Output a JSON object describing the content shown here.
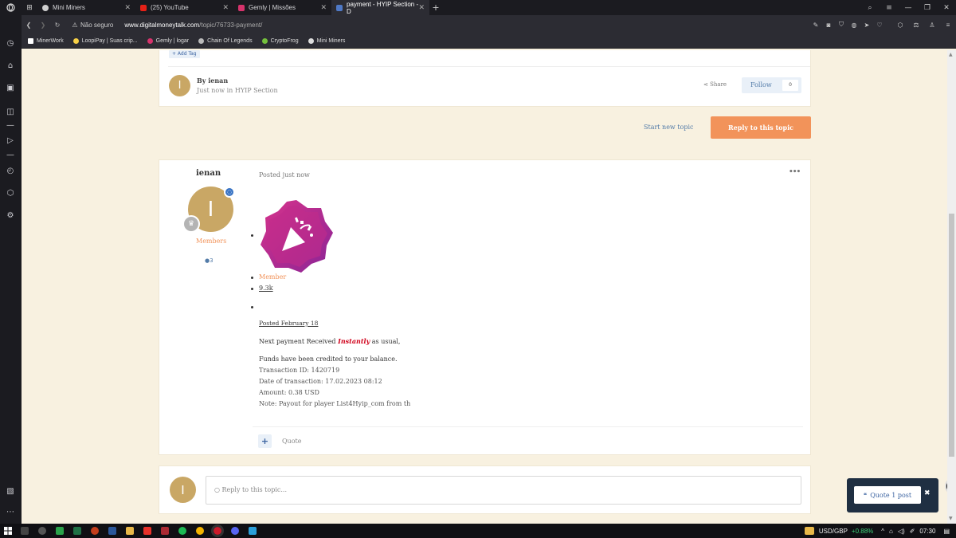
{
  "browser": {
    "tabs": [
      {
        "label": "Mini Miners",
        "color": "#cfcfcf"
      },
      {
        "label": "(25) YouTube",
        "color": "#e62117"
      },
      {
        "label": "Gemly | Missões",
        "color": "#d6336c"
      },
      {
        "label": "payment - HYIP Section - D",
        "color": "#4f79c6"
      }
    ],
    "new_tab": "+",
    "security_label": "Não seguro",
    "url_domain": "www.digitalmoneytalk.com",
    "url_path": "/topic/76733-payment/",
    "bookmarks": [
      {
        "label": "MinerWork",
        "color": "#ffffff"
      },
      {
        "label": "LoopiPay | Suas crip...",
        "color": "#f7d046"
      },
      {
        "label": "Gemly | logar",
        "color": "#d6336c"
      },
      {
        "label": "Chain Of Legends",
        "color": "#bbbbbb"
      },
      {
        "label": "CryptoFrog",
        "color": "#74c03c"
      },
      {
        "label": "Mini Miners",
        "color": "#dddddd"
      }
    ]
  },
  "topic_header": {
    "add_tag": "+ Add Tag",
    "avatar_letter": "I",
    "by_label": "By ienan",
    "meta": "Just now in HYIP Section",
    "share_label": "Share",
    "follow_label": "Follow",
    "follow_count": "0"
  },
  "actions": {
    "start_new_topic": "Start new topic",
    "reply_to_topic": "Reply to this topic"
  },
  "post": {
    "author": "ienan",
    "avatar_letter": "I",
    "group": "Members",
    "post_count": "3",
    "posted": "Posted just now",
    "menu": "•••",
    "badge_label": "Member",
    "reputation": "9.3k",
    "posted_date": "Posted February 18",
    "line1_prefix": "Next payment Received ",
    "line1_emphasis": "Instantly",
    "line1_suffix": " as usual,",
    "funds_line": "Funds have been credited to your balance.",
    "transaction_id": "Transaction ID: 1420719",
    "date_of_transaction": "Date of transaction: 17.02.2023 08:12",
    "amount": "Amount: 0.38 USD",
    "note": "Note: Payout for player List4Hyip_com from th",
    "add_button": "+",
    "quote_label": "Quote"
  },
  "reply": {
    "avatar_letter": "I",
    "placeholder": "Reply to this topic..."
  },
  "quote_popup": {
    "label": "Quote 1 post",
    "close": "✖"
  },
  "taskbar": {
    "ticker": "USD/GBP",
    "change": "+0.88%",
    "time": "07:30"
  },
  "colors": {
    "accent_orange": "#f2935a",
    "link_blue": "#527ba8",
    "page_bg": "#f8f1e0",
    "avatar_gold": "#c9a765",
    "instantly_red": "#d0021b",
    "positive_green": "#3fd17a",
    "badge_magenta": "#c0287f"
  }
}
